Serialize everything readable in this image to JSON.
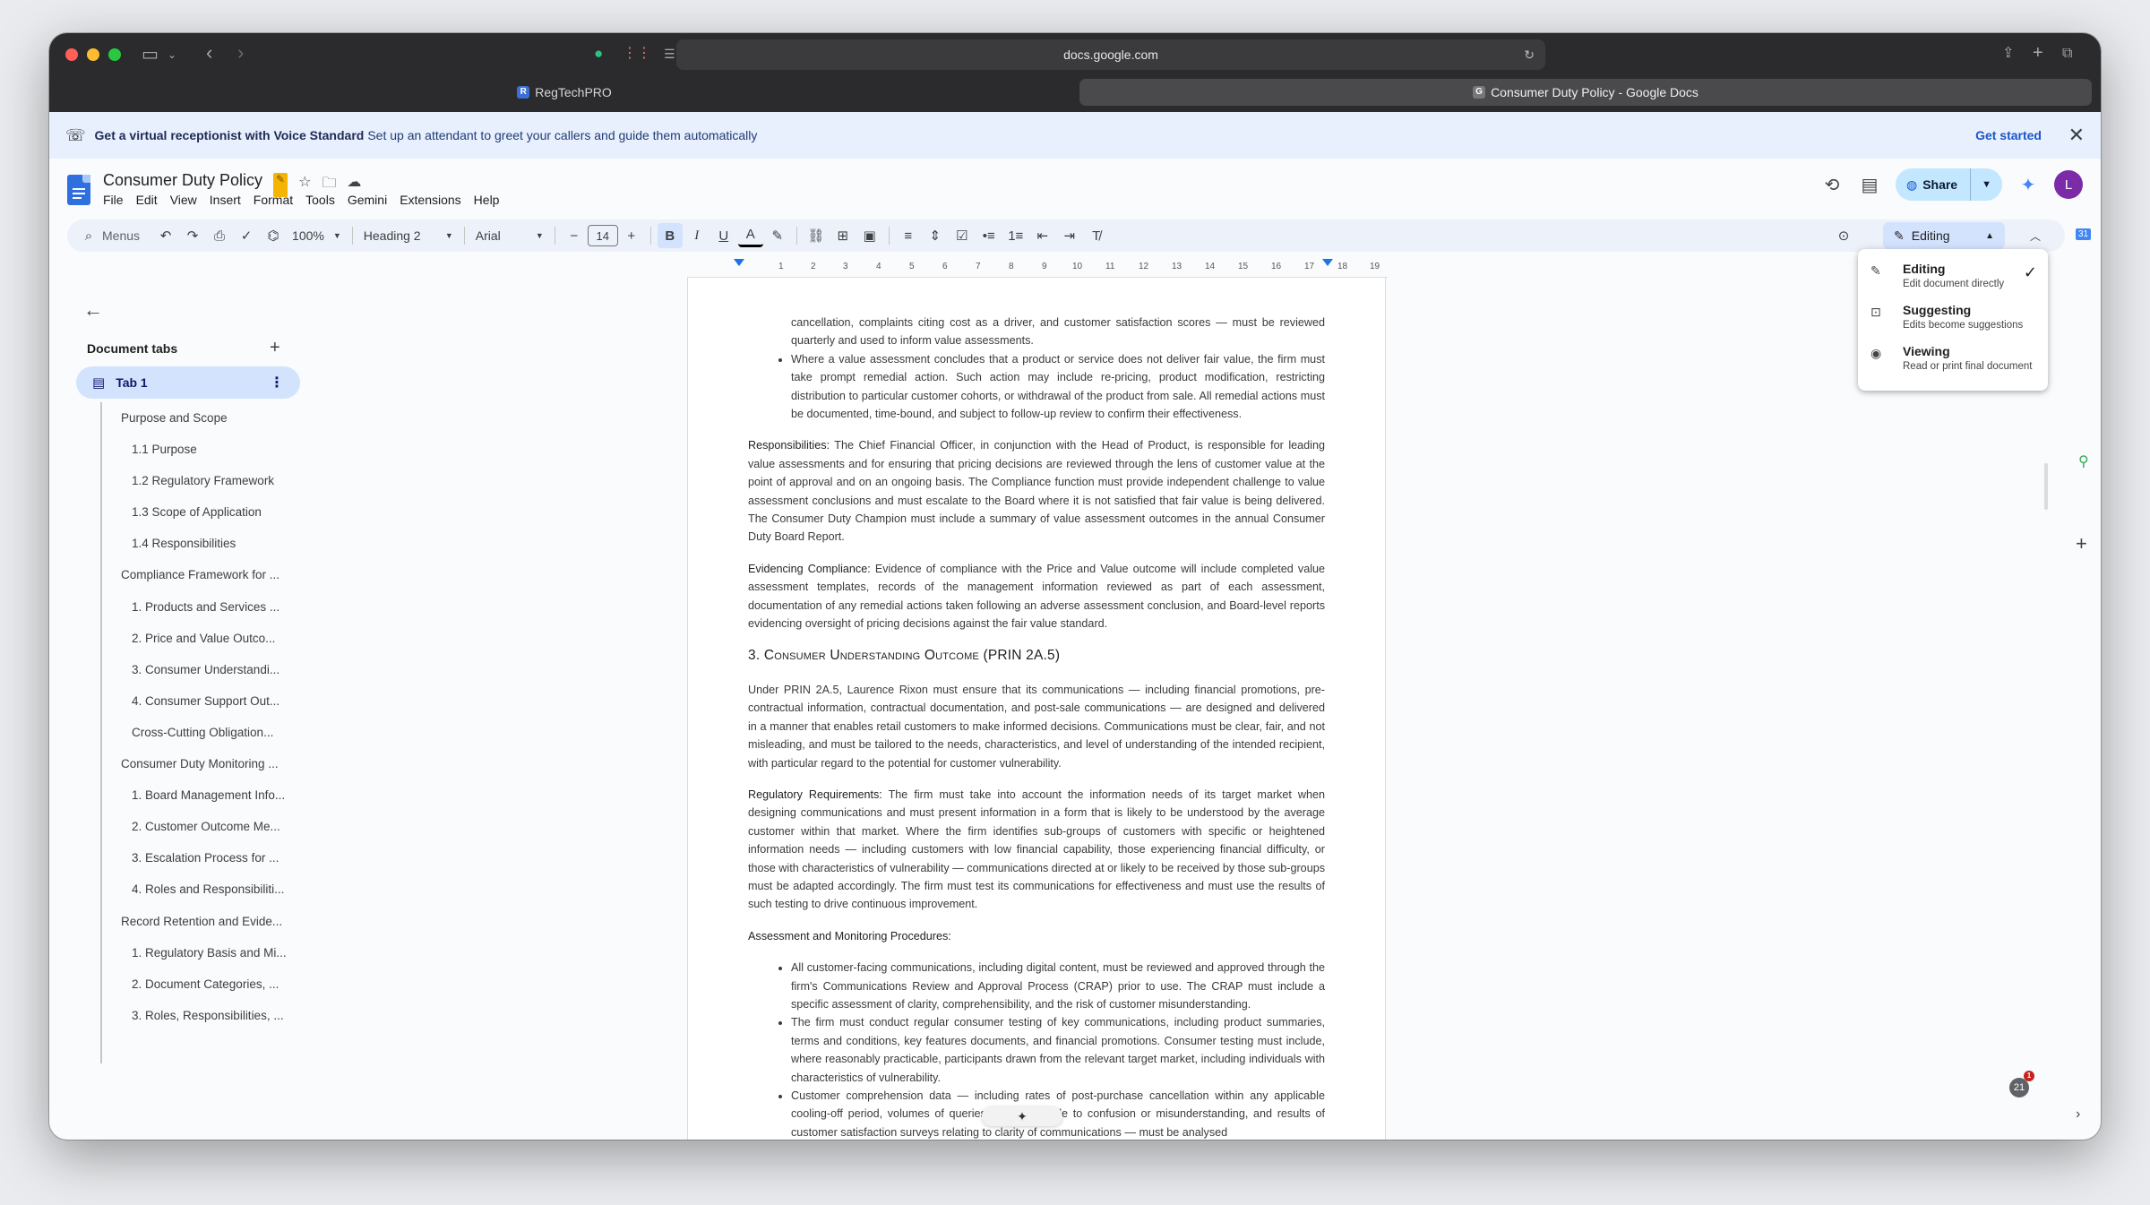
{
  "browser": {
    "url": "docs.google.com",
    "tabs": [
      {
        "label": "RegTechPRO",
        "favicon": "R"
      },
      {
        "label": "Consumer Duty Policy - Google Docs",
        "favicon": "G"
      }
    ]
  },
  "banner": {
    "bold_text": "Get a virtual receptionist with Voice Standard",
    "text": "Set up an attendant to greet your callers and guide them automatically",
    "cta": "Get started"
  },
  "doc": {
    "title": "Consumer Duty Policy",
    "menu": [
      "File",
      "Edit",
      "View",
      "Insert",
      "Format",
      "Tools",
      "Gemini",
      "Extensions",
      "Help"
    ],
    "share_label": "Share",
    "avatar_initial": "L"
  },
  "toolbar": {
    "search": "Menus",
    "zoom": "100%",
    "style": "Heading 2",
    "font": "Arial",
    "font_size": "14",
    "mode": "Editing"
  },
  "ruler": [
    "1",
    "2",
    "3",
    "4",
    "5",
    "6",
    "7",
    "8",
    "9",
    "10",
    "11",
    "12",
    "13",
    "14",
    "15",
    "16",
    "17",
    "18",
    "19"
  ],
  "sidebar": {
    "heading": "Document tabs",
    "tab_label": "Tab 1",
    "outline": [
      {
        "level": 1,
        "text": "Purpose and Scope"
      },
      {
        "level": 2,
        "text": "1.1 Purpose"
      },
      {
        "level": 2,
        "text": "1.2 Regulatory Framework"
      },
      {
        "level": 2,
        "text": "1.3 Scope of Application"
      },
      {
        "level": 2,
        "text": "1.4 Responsibilities"
      },
      {
        "level": 1,
        "text": "Compliance Framework for ..."
      },
      {
        "level": 2,
        "text": "1. Products and Services ..."
      },
      {
        "level": 2,
        "text": "2. Price and Value Outco..."
      },
      {
        "level": 2,
        "text": "3. Consumer Understandi..."
      },
      {
        "level": 2,
        "text": "4. Consumer Support Out..."
      },
      {
        "level": 2,
        "text": "Cross-Cutting Obligation..."
      },
      {
        "level": 1,
        "text": "Consumer Duty Monitoring ..."
      },
      {
        "level": 2,
        "text": "1. Board Management Info..."
      },
      {
        "level": 2,
        "text": "2. Customer Outcome Me..."
      },
      {
        "level": 2,
        "text": "3. Escalation Process for ..."
      },
      {
        "level": 2,
        "text": "4. Roles and Responsibiliti..."
      },
      {
        "level": 1,
        "text": "Record Retention and Evide..."
      },
      {
        "level": 2,
        "text": "1. Regulatory Basis and Mi..."
      },
      {
        "level": 2,
        "text": "2. Document Categories, ..."
      },
      {
        "level": 2,
        "text": "3. Roles, Responsibilities, ..."
      }
    ]
  },
  "content": {
    "cont_para": "cancellation, complaints citing cost as a driver, and customer satisfaction scores — must be reviewed quarterly and used to inform value assessments.",
    "bullet_remedial": "Where a value assessment concludes that a product or service does not deliver fair value, the firm must take prompt remedial action. Such action may include re-pricing, product modification, restricting distribution to particular customer cohorts, or withdrawal of the product from sale. All remedial actions must be documented, time-bound, and subject to follow-up review to confirm their effectiveness.",
    "resp_label": "Responsibilities:",
    "resp_text": "The Chief Financial Officer, in conjunction with the Head of Product, is responsible for leading value assessments and for ensuring that pricing decisions are reviewed through the lens of customer value at the point of approval and on an ongoing basis. The Compliance function must provide independent challenge to value assessment conclusions and must escalate to the Board where it is not satisfied that fair value is being delivered. The Consumer Duty Champion must include a summary of value assessment outcomes in the annual Consumer Duty Board Report.",
    "evid_label": "Evidencing Compliance:",
    "evid_text": "Evidence of compliance with the Price and Value outcome will include completed value assessment templates, records of the management information reviewed as part of each assessment, documentation of any remedial actions taken following an adverse assessment conclusion, and Board-level reports evidencing oversight of pricing decisions against the fair value standard.",
    "section_heading": "3. Consumer Understanding Outcome (PRIN 2A.5)",
    "under_text": "Under PRIN 2A.5, Laurence Rixon must ensure that its communications — including financial promotions, pre-contractual information, contractual documentation, and post-sale communications — are designed and delivered in a manner that enables retail customers to make informed decisions. Communications must be clear, fair, and not misleading, and must be tailored to the needs, characteristics, and level of understanding of the intended recipient, with particular regard to the potential for customer vulnerability.",
    "reg_label": "Regulatory Requirements:",
    "reg_text": "The firm must take into account the information needs of its target market when designing communications and must present information in a form that is likely to be understood by the average customer within that market. Where the firm identifies sub-groups of customers with specific or heightened information needs — including customers with low financial capability, those experiencing financial difficulty, or those with characteristics of vulnerability — communications directed at or likely to be received by those sub-groups must be adapted accordingly. The firm must test its communications for effectiveness and must use the results of such testing to drive continuous improvement.",
    "amp_heading": "Assessment and Monitoring Procedures:",
    "bullets": [
      "All customer-facing communications, including digital content, must be reviewed and approved through the firm's Communications Review and Approval Process (CRAP) prior to use. The CRAP must include a specific assessment of clarity, comprehensibility, and the risk of customer misunderstanding.",
      "The firm must conduct regular consumer testing of key communications, including product summaries, terms and conditions, key features documents, and financial promotions. Consumer testing must include, where reasonably practicable, participants drawn from the relevant target market, including individuals with characteristics of vulnerability.",
      "Customer comprehension data — including rates of post-purchase cancellation within any applicable cooling-off period, volumes of queries a... attributable to confusion or misunderstanding, and results of customer satisfaction surveys relating to clarity of communications — must be analysed"
    ]
  },
  "mode_menu": [
    {
      "title": "Editing",
      "subtitle": "Edit document directly",
      "selected": true
    },
    {
      "title": "Suggesting",
      "subtitle": "Edits become suggestions",
      "selected": false
    },
    {
      "title": "Viewing",
      "subtitle": "Read or print final document",
      "selected": false
    }
  ],
  "notifications": {
    "count": "21",
    "badge": "1"
  },
  "colors": {
    "accent": "#1a73e8",
    "share_bg": "#c2e7ff",
    "tab_active": "#d3e3fd",
    "avatar": "#7b2aa8"
  }
}
